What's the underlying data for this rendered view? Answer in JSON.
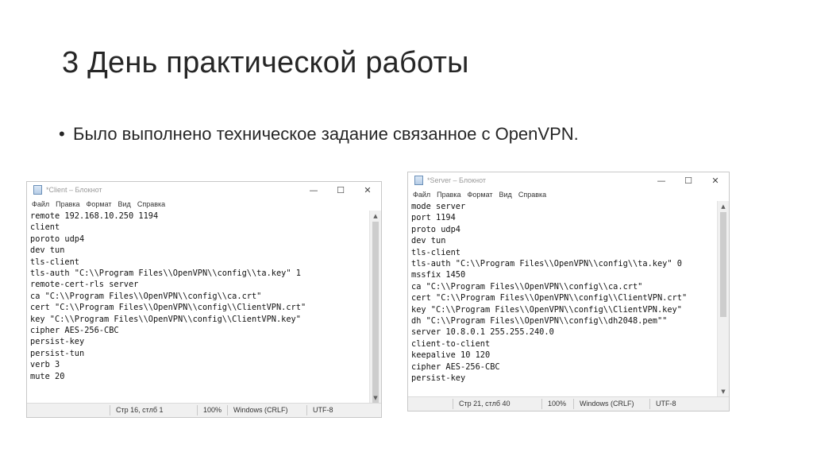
{
  "slide": {
    "title": "3  День практической работы",
    "bullet": "Было выполнено техническое задание связанное с OpenVPN."
  },
  "client_window": {
    "title": "*Client – Блокнот",
    "menu": [
      "Файл",
      "Правка",
      "Формат",
      "Вид",
      "Справка"
    ],
    "lines": [
      "remote 192.168.10.250 1194",
      "client",
      "poroto udp4",
      "dev tun",
      "tls-client",
      "tls-auth \"C:\\\\Program Files\\\\OpenVPN\\\\config\\\\ta.key\" 1",
      "remote-cert-rls server",
      "ca \"C:\\\\Program Files\\\\OpenVPN\\\\config\\\\ca.crt\"",
      "cert \"C:\\\\Program Files\\\\OpenVPN\\\\config\\\\ClientVPN.crt\"",
      "key \"C:\\\\Program Files\\\\OpenVPN\\\\config\\\\ClientVPN.key\"",
      "cipher AES-256-CBC",
      "persist-key",
      "persist-tun",
      "verb 3",
      "mute 20"
    ],
    "status": {
      "position": "Стр 16, стлб 1",
      "zoom": "100%",
      "line_ending": "Windows (CRLF)",
      "encoding": "UTF-8"
    }
  },
  "server_window": {
    "title": "*Server – Блокнот",
    "menu": [
      "Файл",
      "Правка",
      "Формат",
      "Вид",
      "Справка"
    ],
    "lines": [
      "mode server",
      "port 1194",
      "proto udp4",
      "dev tun",
      "tls-client",
      "tls-auth \"C:\\\\Program Files\\\\OpenVPN\\\\config\\\\ta.key\" 0",
      "mssfix 1450",
      "ca \"C:\\\\Program Files\\\\OpenVPN\\\\config\\\\ca.crt\"",
      "cert \"C:\\\\Program Files\\\\OpenVPN\\\\config\\\\ClientVPN.crt\"",
      "key \"C:\\\\Program Files\\\\OpenVPN\\\\config\\\\ClientVPN.key\"",
      "dh \"C:\\\\Program Files\\\\OpenVPN\\\\config\\\\dh2048.pem\"\"",
      "server 10.8.0.1 255.255.240.0",
      "client-to-client",
      "keepalive 10 120",
      "cipher AES-256-CBC",
      "persist-key"
    ],
    "status": {
      "position": "Стр 21, стлб 40",
      "zoom": "100%",
      "line_ending": "Windows (CRLF)",
      "encoding": "UTF-8"
    }
  },
  "icons": {
    "minimize": "minimize-icon",
    "maximize": "maximize-icon",
    "close": "close-icon",
    "notepad": "notepad-icon"
  }
}
